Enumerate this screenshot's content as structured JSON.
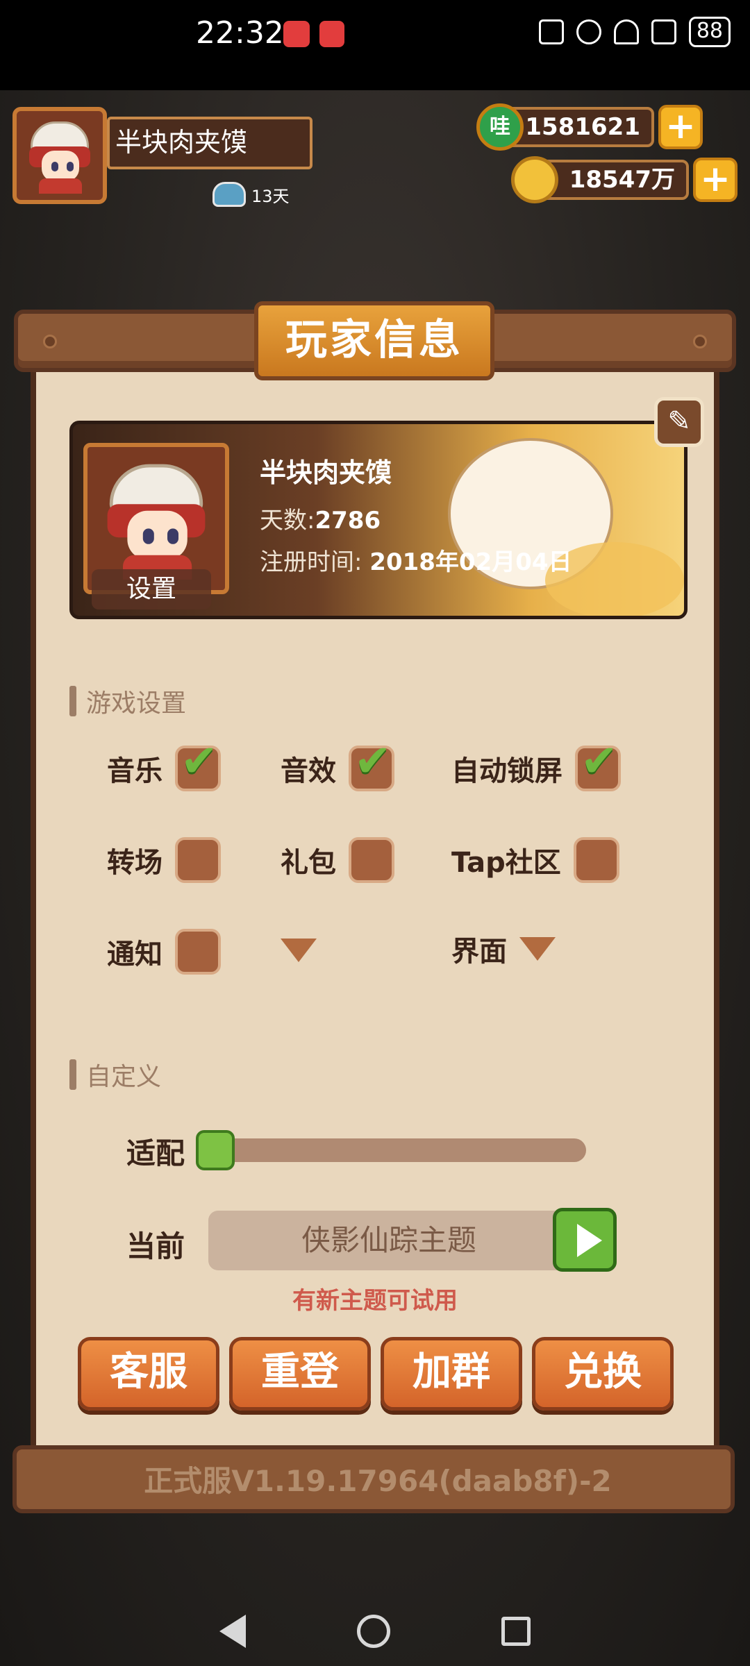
{
  "status_bar": {
    "time": "22:32",
    "battery": "88"
  },
  "hud": {
    "player_name": "半块肉夹馍",
    "days_badge": "13天",
    "jade_amount": "1581621",
    "coin_amount": "18547万",
    "jade_icon_char": "哇",
    "plus": "+"
  },
  "panel": {
    "title": "玩家信息",
    "profile": {
      "name": "半块肉夹馍",
      "days_label": "天数:",
      "days_value": "2786",
      "reg_label": "注册时间:",
      "reg_value": "2018年02月04日",
      "settings_button": "设置"
    },
    "game_settings": {
      "header": "游戏设置",
      "options": [
        {
          "label": "音乐",
          "checked": true
        },
        {
          "label": "音效",
          "checked": true
        },
        {
          "label": "自动锁屏",
          "checked": true
        },
        {
          "label": "转场",
          "checked": false
        },
        {
          "label": "礼包",
          "checked": false
        },
        {
          "label": "Tap社区",
          "checked": false
        },
        {
          "label": "通知",
          "checked": false
        },
        {
          "label": "",
          "checked": false
        },
        {
          "label": "界面",
          "checked": false
        }
      ]
    },
    "custom": {
      "header": "自定义",
      "fit_label": "适配",
      "fit_level": 0,
      "current_label": "当前",
      "theme_value": "侠影仙踪主题",
      "hint": "有新主题可试用"
    },
    "buttons": [
      "客服",
      "重登",
      "加群",
      "兑换"
    ],
    "version": "正式服V1.19.17964(daab8f)-2"
  },
  "colors": {
    "accent_orange": "#d4642a",
    "check_green": "#6fb73e",
    "panel_bg": "#e9d7bd"
  }
}
